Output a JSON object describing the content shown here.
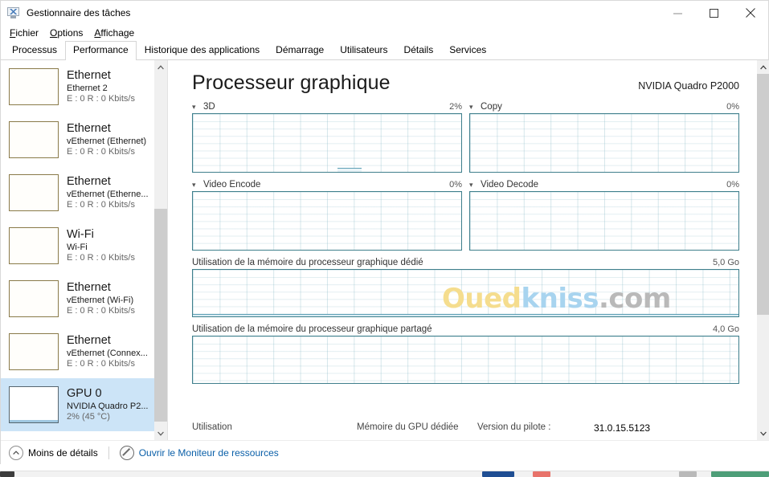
{
  "window": {
    "title": "Gestionnaire des tâches",
    "icon": "task-manager-icon",
    "minimize_label": "—",
    "maximize_label": "□",
    "close_label": "✕"
  },
  "menu": [
    {
      "label": "Fichier",
      "accel": "F"
    },
    {
      "label": "Options",
      "accel": "O"
    },
    {
      "label": "Affichage",
      "accel": "A"
    }
  ],
  "tabs": [
    {
      "label": "Processus",
      "active": false
    },
    {
      "label": "Performance",
      "active": true
    },
    {
      "label": "Historique des applications",
      "active": false
    },
    {
      "label": "Démarrage",
      "active": false
    },
    {
      "label": "Utilisateurs",
      "active": false
    },
    {
      "label": "Détails",
      "active": false
    },
    {
      "label": "Services",
      "active": false
    }
  ],
  "sidebar": {
    "items": [
      {
        "title": "Ethernet",
        "sub": "Ethernet 2",
        "stat": "E : 0 R : 0 Kbits/s",
        "selected": false
      },
      {
        "title": "Ethernet",
        "sub": "vEthernet (Ethernet)",
        "stat": "E : 0 R : 0 Kbits/s",
        "selected": false
      },
      {
        "title": "Ethernet",
        "sub": "vEthernet (Etherne...",
        "stat": "E : 0 R : 0 Kbits/s",
        "selected": false
      },
      {
        "title": "Wi-Fi",
        "sub": "Wi-Fi",
        "stat": "E : 0 R : 0 Kbits/s",
        "selected": false
      },
      {
        "title": "Ethernet",
        "sub": "vEthernet (Wi-Fi)",
        "stat": "E : 0 R : 0 Kbits/s",
        "selected": false
      },
      {
        "title": "Ethernet",
        "sub": "vEthernet (Connex...",
        "stat": "E : 0 R : 0 Kbits/s",
        "selected": false
      },
      {
        "title": "GPU 0",
        "sub": "NVIDIA Quadro P2...",
        "stat": "2%  (45 °C)",
        "selected": true
      }
    ]
  },
  "main": {
    "title": "Processeur graphique",
    "device": "NVIDIA Quadro P2000",
    "graphs": [
      {
        "name": "3D",
        "value": "2%"
      },
      {
        "name": "Copy",
        "value": "0%"
      },
      {
        "name": "Video Encode",
        "value": "0%"
      },
      {
        "name": "Video Decode",
        "value": "0%"
      }
    ],
    "memory": [
      {
        "label": "Utilisation de la mémoire du processeur graphique dédié",
        "value": "5,0 Go"
      },
      {
        "label": "Utilisation de la mémoire du processeur graphique partagé",
        "value": "4,0 Go"
      }
    ],
    "stats": [
      {
        "label": "Utilisation",
        "value": ""
      },
      {
        "label": "Mémoire du GPU dédiée",
        "value": ""
      },
      {
        "label": "Version du pilote :",
        "value": ""
      },
      {
        "label": "",
        "value": "31.0.15.5123"
      }
    ],
    "watermark": {
      "part1": "Oued",
      "part2": "kniss",
      "part3": ".com"
    }
  },
  "footer": {
    "less_details": "Moins de détails",
    "less_details_accel": "d",
    "resource_monitor": "Ouvrir le Moniteur de ressources"
  },
  "colors": {
    "accent": "#3f7f8c",
    "selection": "#cce4f7",
    "link": "#0a5fa8",
    "watermark_yellow": "#f5dd8e",
    "watermark_blue": "#a8d4ef",
    "watermark_grey": "#b9b9b9"
  }
}
